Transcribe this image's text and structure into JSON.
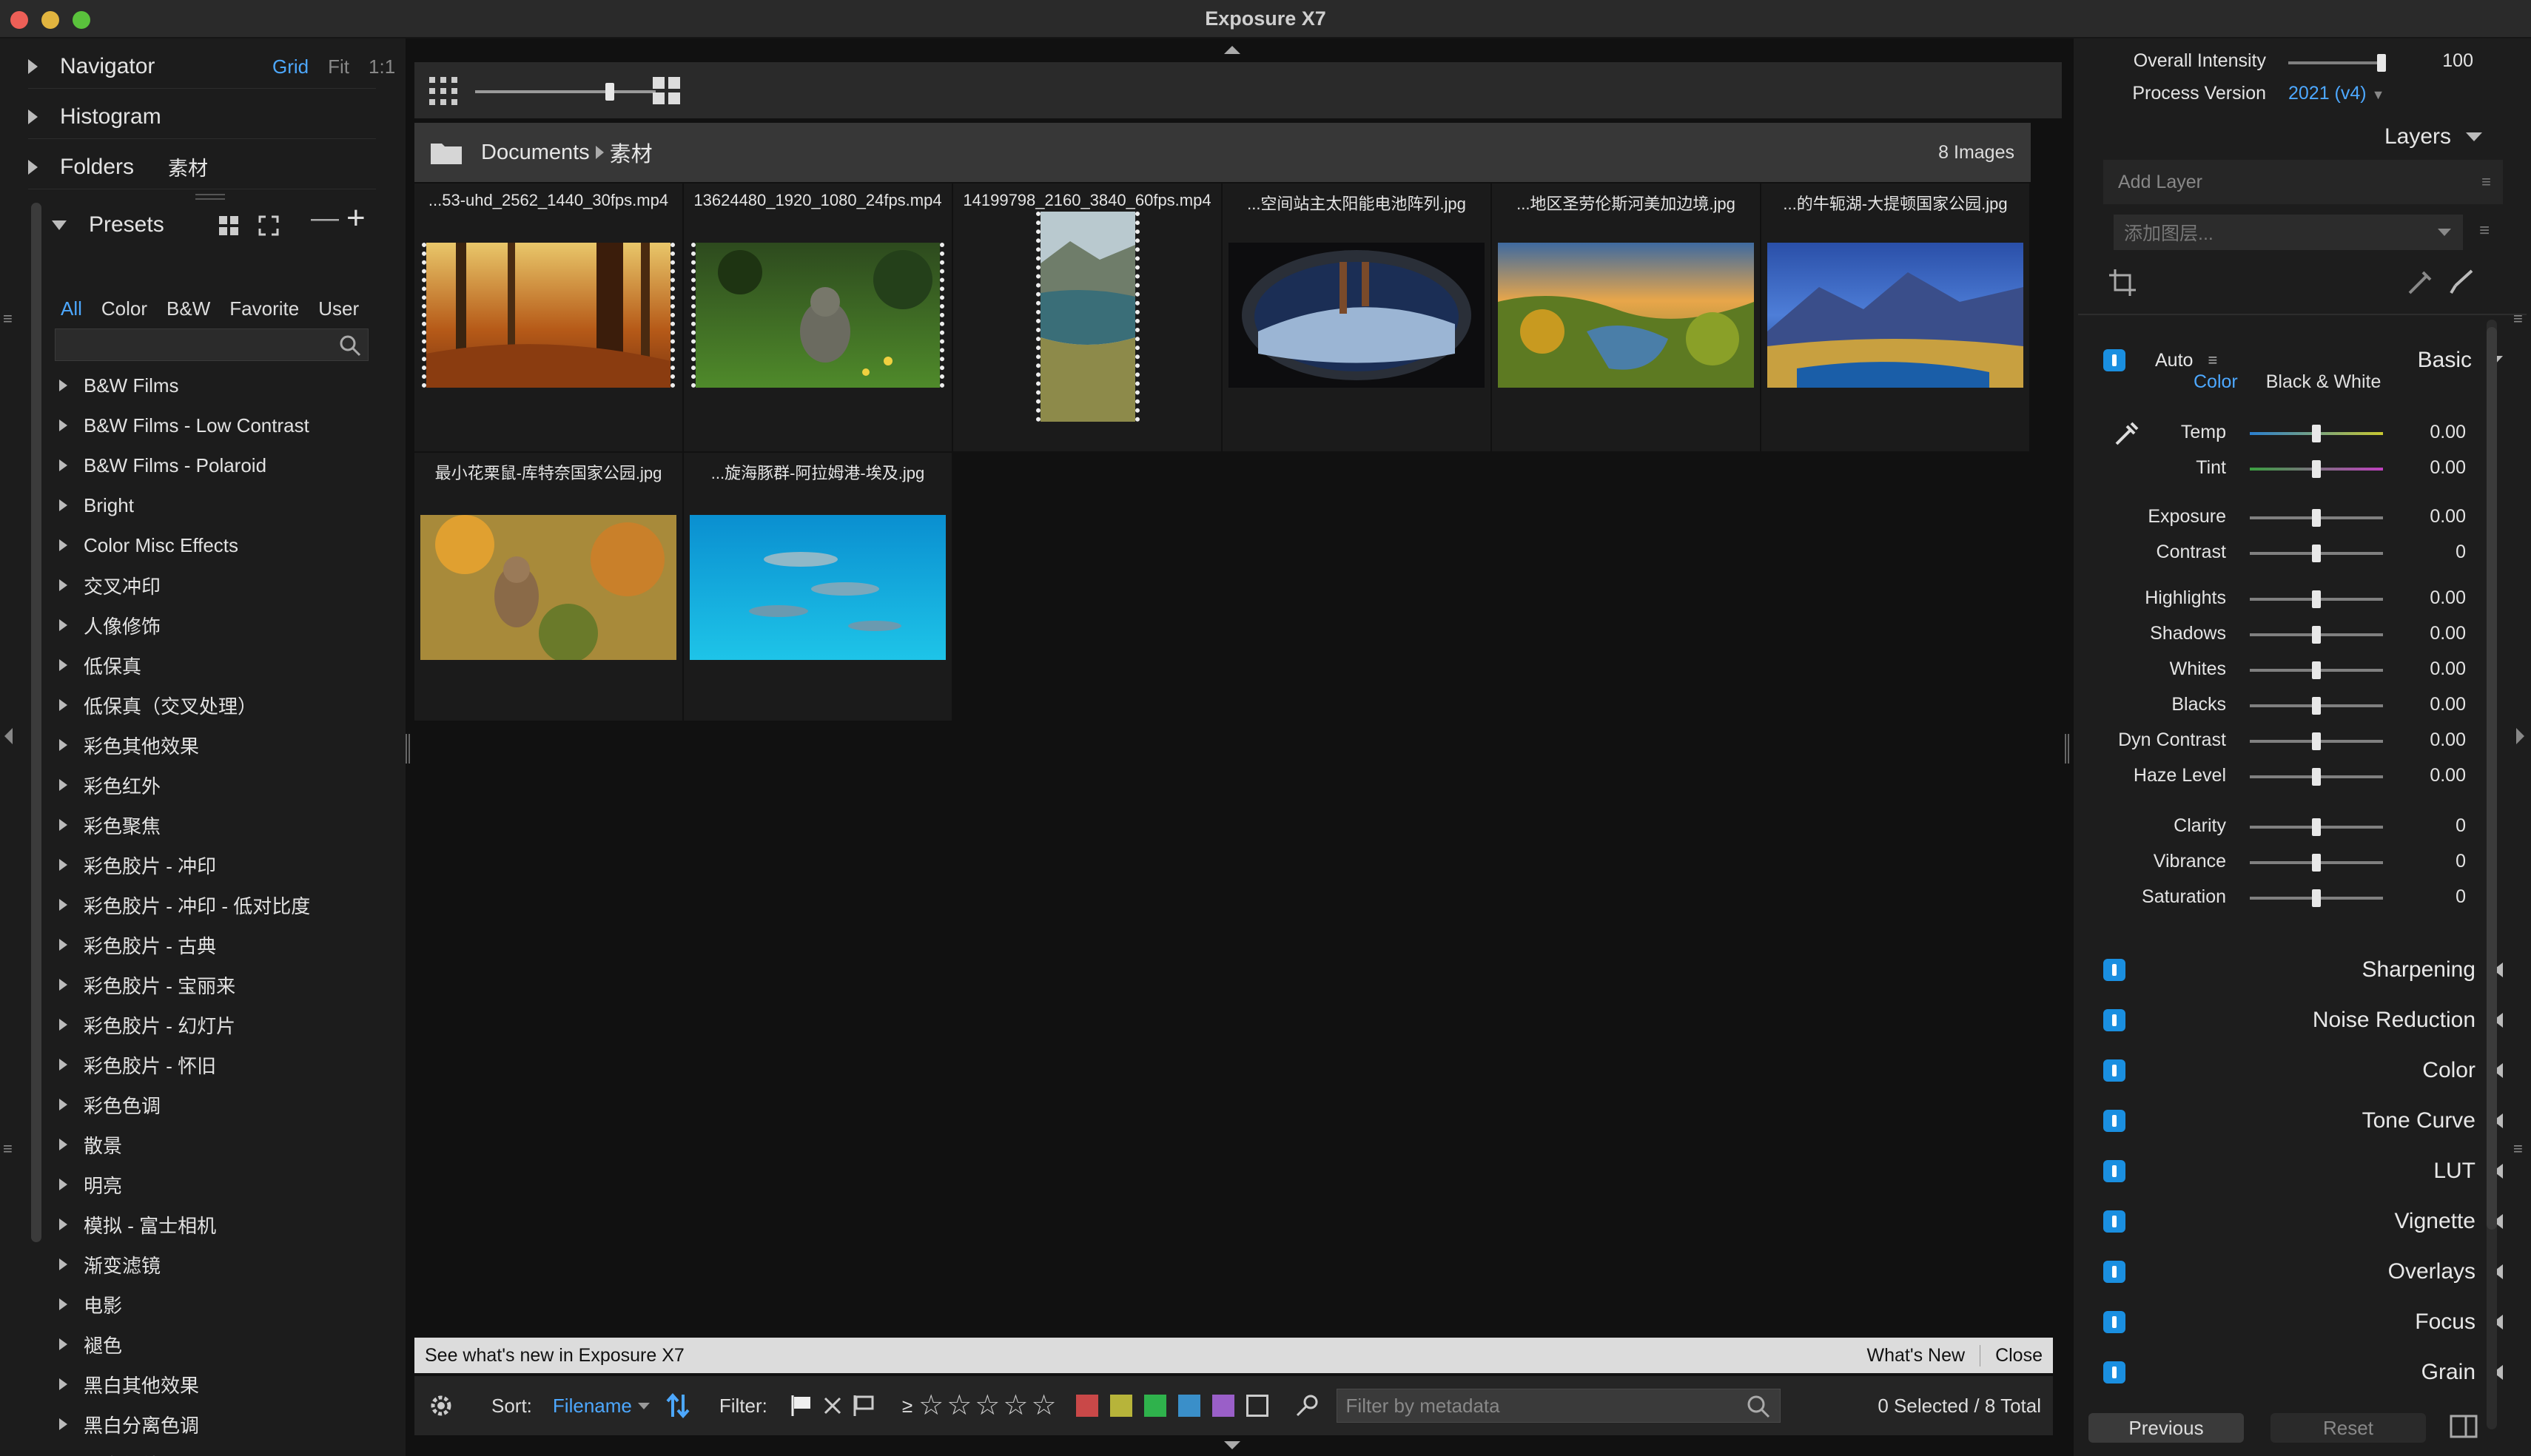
{
  "window": {
    "title": "Exposure X7"
  },
  "left_panel": {
    "navigator": {
      "label": "Navigator",
      "modes": [
        "Grid",
        "Fit",
        "1:1"
      ]
    },
    "histogram": {
      "label": "Histogram"
    },
    "folders": {
      "label": "Folders",
      "current": "素材"
    },
    "presets": {
      "label": "Presets",
      "tabs": [
        "All",
        "Color",
        "B&W",
        "Favorite",
        "User"
      ],
      "active_tab": "All",
      "items": [
        "B&W Films",
        "B&W Films - Low Contrast",
        "B&W Films - Polaroid",
        "Bright",
        "Color Misc Effects",
        "交叉冲印",
        "人像修饰",
        "低保真",
        "低保真（交叉处理）",
        "彩色其他效果",
        "彩色红外",
        "彩色聚焦",
        "彩色胶片 - 冲印",
        "彩色胶片 - 冲印 - 低对比度",
        "彩色胶片 - 古典",
        "彩色胶片 - 宝丽来",
        "彩色胶片 - 幻灯片",
        "彩色胶片 - 怀旧",
        "彩色色调",
        "散景",
        "明亮",
        "模拟 - 富士相机",
        "渐变滤镜",
        "电影",
        "褪色",
        "黑白其他效果",
        "黑白分离色调",
        "黑白红外"
      ]
    }
  },
  "browser": {
    "path": [
      "Documents",
      "素材"
    ],
    "image_count": "8 Images",
    "images": [
      {
        "name": "...53-uhd_2562_1440_30fps.mp4",
        "kind": "video",
        "icon": "forest-thumbnail"
      },
      {
        "name": "13624480_1920_1080_24fps.mp4",
        "kind": "video",
        "icon": "cat-thumbnail"
      },
      {
        "name": "14199798_2160_3840_60fps.mp4",
        "kind": "video-portrait",
        "icon": "mountain-lake-thumbnail"
      },
      {
        "name": "...空间站主太阳能电池阵列.jpg",
        "kind": "photo",
        "icon": "space-station-thumbnail"
      },
      {
        "name": "...地区圣劳伦斯河美加边境.jpg",
        "kind": "photo",
        "icon": "river-islands-thumbnail"
      },
      {
        "name": "...的牛轭湖-大提顿国家公园.jpg",
        "kind": "photo",
        "icon": "oxbow-lake-thumbnail"
      },
      {
        "name": "最小花栗鼠-库特奈国家公园.jpg",
        "kind": "photo",
        "icon": "chipmunk-thumbnail"
      },
      {
        "name": "...旋海豚群-阿拉姆港-埃及.jpg",
        "kind": "photo",
        "icon": "dolphins-thumbnail"
      }
    ],
    "news": {
      "text": "See what's new in Exposure X7",
      "whats_new": "What's New",
      "close": "Close"
    },
    "bottom": {
      "sort_label": "Sort:",
      "sort_value": "Filename",
      "filter_label": "Filter:",
      "rating_prefix": "≥",
      "stars": [
        "☆",
        "☆",
        "☆",
        "☆",
        "☆"
      ],
      "color_labels": [
        "#c94848",
        "#b7b43a",
        "#2fb24c",
        "#3a8fc9",
        "#9a5fc8"
      ],
      "metadata_placeholder": "Filter by metadata",
      "selection": "0 Selected / 8 Total"
    }
  },
  "right_panel": {
    "overall_intensity": {
      "label": "Overall Intensity",
      "value": "100",
      "level": 1.0
    },
    "process_version": {
      "label": "Process Version",
      "value": "2021 (v4)"
    },
    "layers": {
      "label": "Layers",
      "add_layer": "Add Layer",
      "add_placeholder": "添加图层..."
    },
    "basic": {
      "auto_label": "Auto",
      "label": "Basic",
      "tabs": [
        "Color",
        "Black & White"
      ],
      "active_tab": "Color",
      "sliders": [
        {
          "label": "Temp",
          "value": "0.00"
        },
        {
          "label": "Tint",
          "value": "0.00"
        },
        {
          "label": "Exposure",
          "value": "0.00"
        },
        {
          "label": "Contrast",
          "value": "0"
        },
        {
          "label": "Highlights",
          "value": "0.00"
        },
        {
          "label": "Shadows",
          "value": "0.00"
        },
        {
          "label": "Whites",
          "value": "0.00"
        },
        {
          "label": "Blacks",
          "value": "0.00"
        },
        {
          "label": "Dyn Contrast",
          "value": "0.00"
        },
        {
          "label": "Haze Level",
          "value": "0.00"
        },
        {
          "label": "Clarity",
          "value": "0"
        },
        {
          "label": "Vibrance",
          "value": "0"
        },
        {
          "label": "Saturation",
          "value": "0"
        }
      ]
    },
    "sections": [
      "Sharpening",
      "Noise Reduction",
      "Color",
      "Tone Curve",
      "LUT",
      "Vignette",
      "Overlays",
      "Focus",
      "Grain"
    ],
    "footer": {
      "previous": "Previous",
      "reset": "Reset"
    }
  }
}
